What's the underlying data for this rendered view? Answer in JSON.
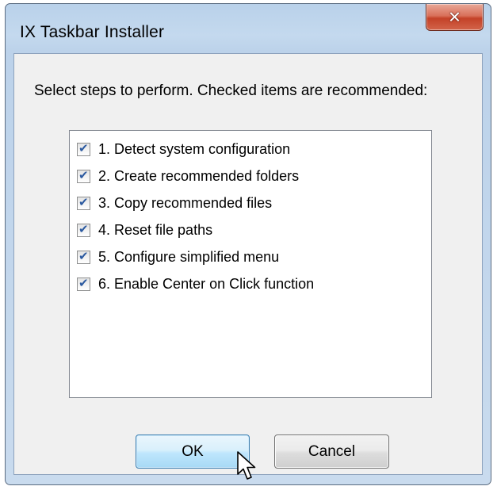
{
  "window": {
    "title": "IX Taskbar Installer",
    "close_glyph": "✕"
  },
  "instruction": "Select steps to perform.  Checked items are recommended:",
  "steps": [
    {
      "label": "1. Detect system configuration",
      "checked": true
    },
    {
      "label": "2. Create recommended folders",
      "checked": true
    },
    {
      "label": "3. Copy recommended files",
      "checked": true
    },
    {
      "label": "4. Reset file paths",
      "checked": true
    },
    {
      "label": "5. Configure simplified menu",
      "checked": true
    },
    {
      "label": "6. Enable Center on Click function",
      "checked": true
    }
  ],
  "buttons": {
    "ok_label": "OK",
    "cancel_label": "Cancel"
  },
  "icons": {
    "check": "✔",
    "close": "close-icon",
    "cursor": "mouse-pointer-icon"
  }
}
